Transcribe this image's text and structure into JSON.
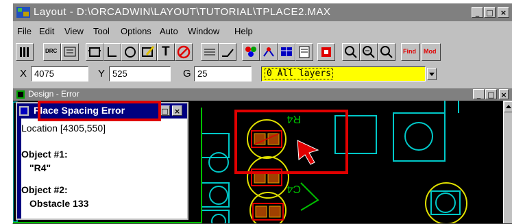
{
  "window": {
    "title": "Layout - D:\\ORCADWIN\\LAYOUT\\TUTORIAL\\TPLACE2.MAX",
    "minimize_label": "_",
    "maximize_label": "□",
    "close_label": "×"
  },
  "menu": {
    "items": [
      {
        "label": "File"
      },
      {
        "label": "Edit"
      },
      {
        "label": "View"
      },
      {
        "label": "Tool"
      },
      {
        "label": "Options"
      },
      {
        "label": "Auto"
      },
      {
        "label": "Window"
      },
      {
        "label": "Help"
      }
    ]
  },
  "toolbar": {
    "find_label": "Find",
    "mod_label": "Mod",
    "drc_label": "DRC",
    "t_label": "T"
  },
  "status": {
    "x_label": "X",
    "x_value": "4075",
    "y_label": "Y",
    "y_value": "525",
    "g_label": "G",
    "g_value": "25",
    "layer_value": "0 All layers",
    "layer_color": "#ffff00"
  },
  "design_window": {
    "title": "Design - Error"
  },
  "dialog": {
    "title": "Place Spacing Error",
    "location_text": "Location [4305,550]",
    "object1_label": "Object #1:",
    "object1_value": "\"R4\"",
    "object2_label": "Object #2:",
    "object2_value": "Obstacle 133"
  },
  "pcb": {
    "silk_label_top": "R4",
    "silk_label_mid": "C4"
  },
  "colors": {
    "highlight_red": "#e00000",
    "board_bg": "#000000",
    "pad_cyan": "#00c8c8",
    "silk_yellow": "#e0e000",
    "outline_green": "#00c000"
  }
}
